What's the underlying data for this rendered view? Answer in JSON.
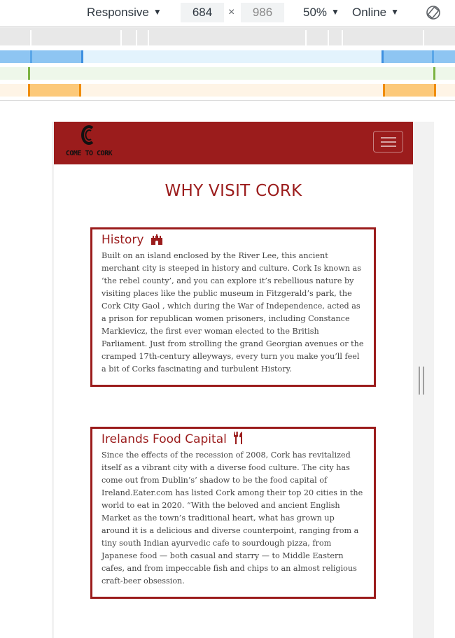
{
  "devtools": {
    "device_label": "Responsive",
    "width_value": "684",
    "height_value": "986",
    "times_symbol": "×",
    "zoom_label": "50%",
    "network_label": "Online",
    "icons": [
      "chevron-down-icon",
      "rotate-icon"
    ]
  },
  "site": {
    "logo_text": "COME TO CORK",
    "page_title": "WHY VISIT CORK",
    "brand_color": "#9b1c1c",
    "cards": [
      {
        "title": "History",
        "icon": "castle-icon",
        "text": "Built on an island enclosed by the River Lee, this ancient merchant city is steeped in history and culture. Cork Is known as ‘the rebel county’, and you can explore it’s rebellious nature by visiting places like the public museum in Fitzgerald’s park, the Cork City Gaol , which during the War of Independence, acted as a prison for republican women prisoners, including Constance Markievicz, the first ever woman elected to the British Parliament. Just from strolling the grand Georgian avenues or the cramped 17th-century alleyways, every turn you make you’ll feel a bit of Corks fascinating and turbulent History."
      },
      {
        "title": "Irelands Food Capital",
        "icon": "utensils-icon",
        "text": "Since the effects of the recession of 2008, Cork has revitalized itself as a vibrant city with a diverse food culture. The city has come out from Dublin’s’ shadow to be the food capital of Ireland.Eater.com has listed Cork among their top 20 cities in the world to eat in 2020. “With the beloved and ancient English Market as the town’s traditional heart, what has grown up around it is a delicious and diverse counterpoint, ranging from a tiny south Indian ayurvedic cafe to sourdough pizza, from Japanese food — both casual and starry — to Middle Eastern cafes, and from impeccable fish and chips to an almost religious craft-beer obsession."
      }
    ]
  }
}
